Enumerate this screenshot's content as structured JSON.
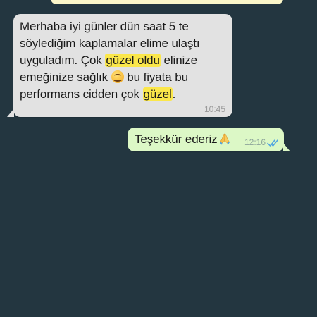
{
  "chat": {
    "incoming": {
      "text_before_1": "Merhaba iyi günler dün saat 5 te söylediğim kaplamalar elime ulaştı uyguladım. Çok ",
      "highlight_1": "güzel oldu",
      "text_between": " elinize emeğinize sağlık ",
      "emoji": "smiling-face-with-hand-over-mouth",
      "text_after_emoji": " bu fiyata bu performans cidden çok ",
      "highlight_2": "güzel",
      "text_end": ".",
      "time": "10:45"
    },
    "outgoing": {
      "text": "Teşekkür ederiz",
      "emoji": "folded-hands",
      "time": "12:16",
      "status": "read"
    }
  },
  "colors": {
    "background": "#233640",
    "incoming_bubble": "#E2E2E2",
    "outgoing_bubble": "#DCF8C6",
    "highlight": "#FBE74A",
    "read_ticks": "#4FA3E0"
  }
}
